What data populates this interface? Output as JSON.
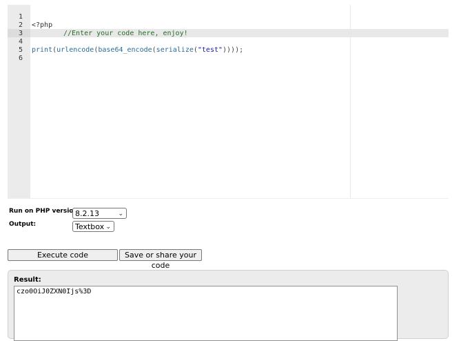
{
  "editor": {
    "line_numbers": [
      "1",
      "2",
      "3",
      "4",
      "5",
      "6"
    ],
    "lines": {
      "l1": "<?php",
      "l2_comment": "//Enter your code here, enjoy!",
      "l4": {
        "fn_print": "print",
        "p1": "(",
        "fn_urlencode": "urlencode",
        "p2": "(",
        "fn_base64": "base64_encode",
        "p3": "(",
        "fn_serialize": "serialize",
        "p4": "(",
        "str": "\"test\"",
        "close": "))));"
      }
    }
  },
  "options": {
    "php_version_label": "Run on PHP version:",
    "php_version_value": "8.2.13",
    "output_label": "Output:",
    "output_value": "Textbox"
  },
  "buttons": {
    "execute": "Execute code",
    "save_share": "Save or share your code"
  },
  "result": {
    "label": "Result:",
    "value": "czo0OiJ0ZXN0Ijs%3D"
  }
}
